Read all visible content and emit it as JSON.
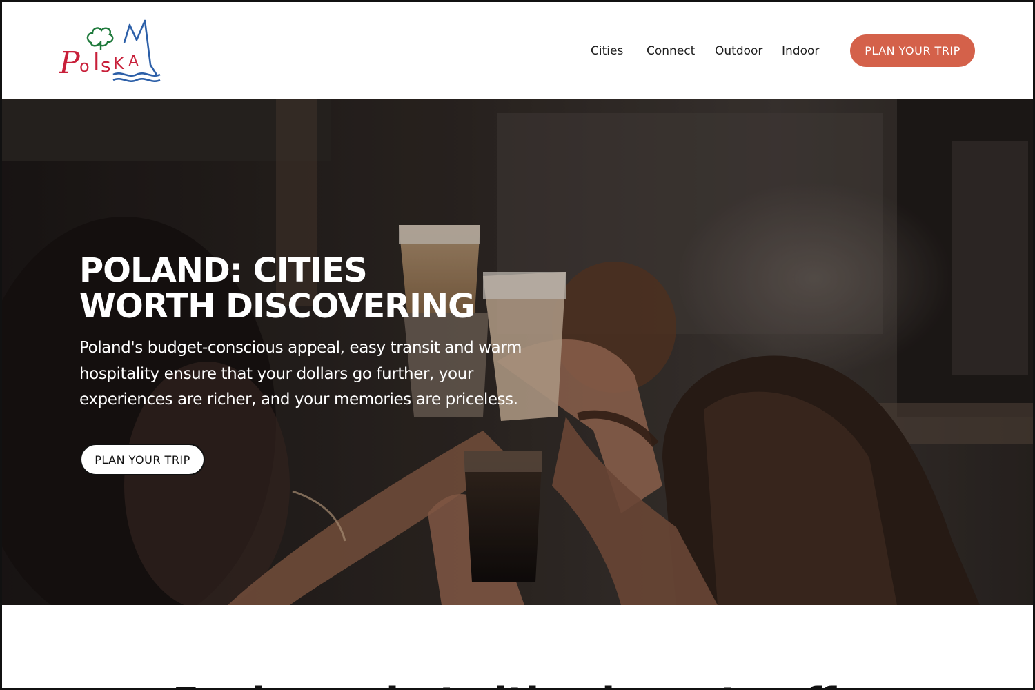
{
  "brand": {
    "logo_text": "Polska",
    "colors": {
      "red": "#c8203a",
      "green": "#1f7a3c",
      "blue": "#2c5fa8",
      "accent": "#d4614a"
    }
  },
  "nav": {
    "items": [
      {
        "label": "Cities"
      },
      {
        "label": "Connect"
      },
      {
        "label": "Outdoor"
      },
      {
        "label": "Indoor"
      }
    ],
    "cta_label": "PLAN YOUR TRIP"
  },
  "hero": {
    "title_line1": "POLAND: CITIES",
    "title_line2": "WORTH DISCOVERING",
    "description": "Poland's budget-conscious appeal, easy transit and warm hospitality ensure that your dollars go further, your experiences are richer, and your memories are priceless.",
    "cta_label": "PLAN YOUR TRIP"
  },
  "next_section": {
    "heading_partial": "Explore what cities have to offer"
  }
}
